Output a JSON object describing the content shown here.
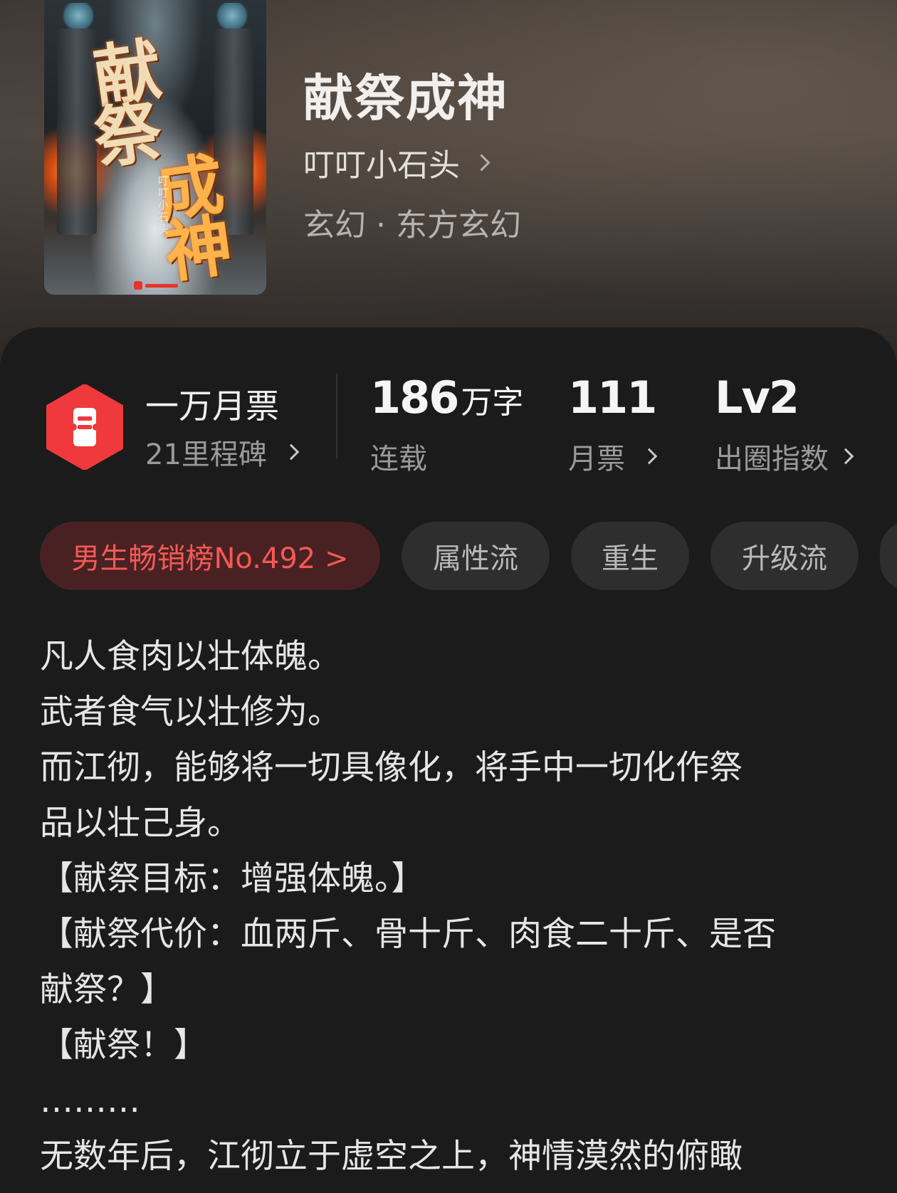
{
  "book": {
    "title": "献祭成神",
    "author": "叮叮小石头",
    "genre": "玄幻 · 东方玄幻",
    "cover": {
      "title_chars": [
        "献",
        "祭",
        "成神"
      ],
      "author_vertical": "叮叮小石头",
      "publisher_logo": "起点读书"
    }
  },
  "stats": {
    "monthly_ticket_label": "一万月票",
    "milestone_label": "21里程碑",
    "word_count_value": "186",
    "word_count_unit": "万字",
    "status": "连载",
    "tickets_value": "111",
    "tickets_label": "月票",
    "influence_value": "Lv2",
    "influence_label": "出圈指数"
  },
  "tags": {
    "rank": "男生畅销榜No.492 >",
    "items": [
      "属性流",
      "重生",
      "升级流"
    ]
  },
  "description": {
    "lines": [
      "凡人食肉以壮体魄。",
      "武者食气以壮修为。",
      "而江彻，能够将一切具像化，将手中一切化作祭",
      "品以壮己身。",
      "【献祭目标：增强体魄。】",
      "【献祭代价：血两斤、骨十斤、肉食二十斤、是否",
      "献祭？】",
      "【献祭！】",
      "………",
      "无数年后，江彻立于虚空之上，神情漠然的俯瞰"
    ]
  },
  "colors": {
    "accent_red": "#f0393c",
    "rank_text": "#f25a55",
    "background": "#1b1b1b"
  },
  "icons": {
    "ticket": "ticket-icon",
    "chevron": "chevron-right-icon"
  }
}
